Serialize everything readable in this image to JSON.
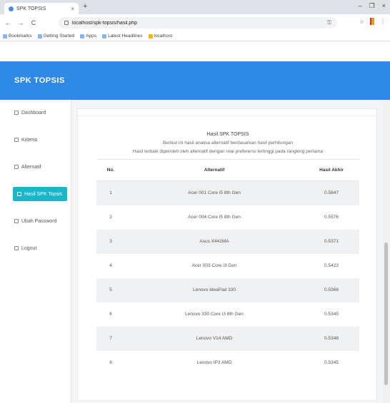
{
  "browser": {
    "tab_title": "SPK TOPSIS",
    "tab_close": "×",
    "new_tab": "+",
    "window_controls": [
      "–",
      "❐",
      "×"
    ],
    "nav": [
      "←",
      "→",
      "C"
    ],
    "url": "localhost/spk-topsis/hasil.php",
    "key_icon": "⚿",
    "toolbar_icons": [
      "☆",
      "⋮"
    ],
    "bookmarks": [
      "Bookmarks",
      "Getting Started",
      "Apps",
      "Latest Headlines",
      "localhost"
    ]
  },
  "app": {
    "brand": "SPK TOPSIS",
    "accent_color": "#2f8ae7",
    "active_color": "#19b5c9"
  },
  "sidebar": {
    "items": [
      {
        "label": "Dashboard",
        "active": false
      },
      {
        "label": "Kriteria",
        "active": false
      },
      {
        "label": "Alternatif",
        "active": false
      },
      {
        "label": "Hasil SPK Topsis",
        "active": true
      },
      {
        "label": "Ubah Password",
        "active": false
      },
      {
        "label": "Logout",
        "active": false
      }
    ]
  },
  "report": {
    "title": "Hasil SPK TOPSIS",
    "subtitle": "Berikut ini hasil analisa alternatif berdasarkan hasil perhitungan",
    "subtitle2": "Hasil terbaik diperoleh oleh alternatif dengan nilai preferensi tertinggi pada rangking pertama"
  },
  "table": {
    "headers": {
      "no": "No.",
      "alternatif": "Alternatif",
      "nilai": "Hasil Akhir"
    },
    "rows": [
      {
        "no": "1",
        "alternatif": "Acer 001 Core i5 8th Gen",
        "nilai": "0.5847"
      },
      {
        "no": "2",
        "alternatif": "Acer 004 Core i5 8th Gen",
        "nilai": "0.5576"
      },
      {
        "no": "3",
        "alternatif": "Asus X441MA",
        "nilai": "0.5371"
      },
      {
        "no": "4",
        "alternatif": "Acer 003 Core i3 Gen",
        "nilai": "0.5423"
      },
      {
        "no": "5",
        "alternatif": "Lenovo IdeaPad 330",
        "nilai": "0.5368"
      },
      {
        "no": "6",
        "alternatif": "Lenovo 330 Core i3 8th Gen",
        "nilai": "0.5345"
      },
      {
        "no": "7",
        "alternatif": "Lenovo V14 AMD",
        "nilai": "0.5348"
      },
      {
        "no": "8",
        "alternatif": "Lenovo IP3 AMD",
        "nilai": "0.5345"
      }
    ]
  }
}
